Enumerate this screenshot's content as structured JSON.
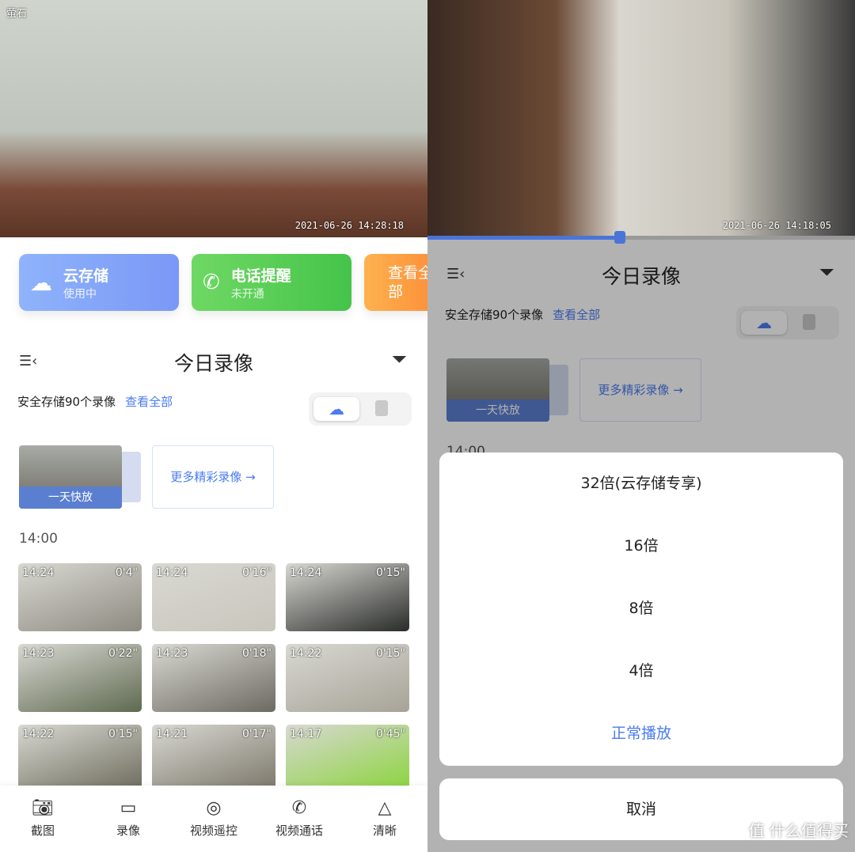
{
  "left": {
    "logo": "萤石",
    "video_timestamp": "2021-06-26 14:28:18",
    "cards": [
      {
        "title": "云存储",
        "subtitle": "使用中",
        "icon": "cloud-upload-icon"
      },
      {
        "title": "电话提醒",
        "subtitle": "未开通",
        "icon": "phone-ring-icon"
      },
      {
        "title": "查看全部"
      }
    ],
    "header": {
      "title": "今日录像"
    },
    "storage_info": "安全存储90个录像",
    "view_all": "查看全部",
    "fast_play": "一天快放",
    "more_videos": "更多精彩录像 →",
    "hour": "14:00",
    "clips": [
      {
        "time": "14:24",
        "duration": "0'4\""
      },
      {
        "time": "14:24",
        "duration": "0'16\""
      },
      {
        "time": "14:24",
        "duration": "0'15\""
      },
      {
        "time": "14:23",
        "duration": "0'22\""
      },
      {
        "time": "14:23",
        "duration": "0'18\""
      },
      {
        "time": "14:22",
        "duration": "0'15\""
      },
      {
        "time": "14:22",
        "duration": "0'15\""
      },
      {
        "time": "14:21",
        "duration": "0'17\""
      },
      {
        "time": "14:17",
        "duration": "0'45\""
      }
    ],
    "toolbar": [
      {
        "label": "截图",
        "icon": "camera-icon"
      },
      {
        "label": "录像",
        "icon": "video-camera-icon"
      },
      {
        "label": "视频遥控",
        "icon": "remote-control-icon"
      },
      {
        "label": "视频通话",
        "icon": "video-call-icon"
      },
      {
        "label": "清晰",
        "icon": "quality-icon"
      }
    ]
  },
  "right": {
    "video_timestamp": "2021-06-26 14:18:05",
    "playback_progress": 0.45,
    "header": {
      "title": "今日录像"
    },
    "storage_info": "安全存储90个录像",
    "view_all": "查看全部",
    "fast_play": "一天快放",
    "more_videos": "更多精彩录像 →",
    "hour": "14:00",
    "speed_options": [
      "32倍(云存储专享)",
      "16倍",
      "8倍",
      "4倍",
      "正常播放"
    ],
    "cancel": "取消",
    "watermark": "值 什么值得买"
  },
  "colors": {
    "accent": "#4a7cf0",
    "cloud_card": "#7a98f6",
    "phone_card": "#45c44a",
    "view_card": "#fd8f3a"
  }
}
